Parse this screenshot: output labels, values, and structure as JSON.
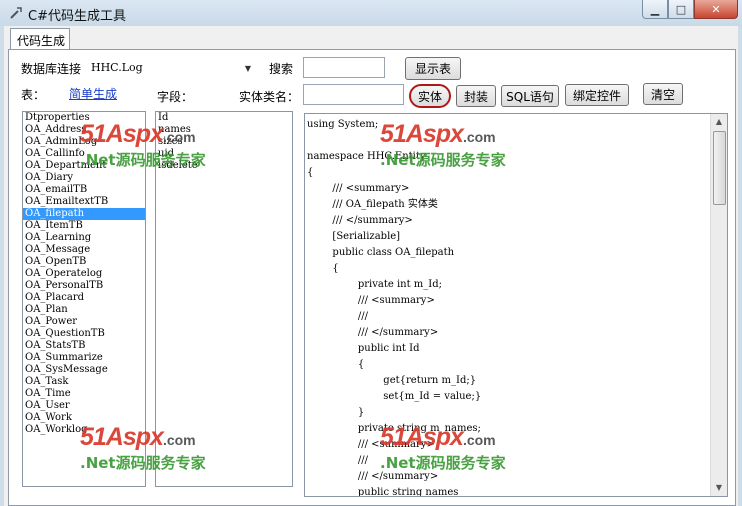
{
  "window": {
    "title": "C#代码生成工具",
    "minimize": "▁",
    "maximize": "□",
    "close": "✕"
  },
  "tab": {
    "label": "代码生成"
  },
  "toolbar": {
    "db_label": "数据库连接",
    "db_value": "HHC.Log",
    "search_label": "搜索",
    "search_value": "",
    "show_tables_button": "显示表",
    "table_label": "表：",
    "simple_generate_link": "简单生成",
    "fields_label": "字段：",
    "entity_class_label": "实体类名：",
    "entity_class_value": "",
    "entity_button": "实体",
    "encapsulate_button": "封装",
    "sql_button": "SQL语句",
    "bind_controls_button": "绑定控件",
    "clear_button": "清空"
  },
  "tables": [
    "Dtproperties",
    "OA_Address",
    "OA_AdminLog",
    "OA_Callinfo",
    "OA_Department",
    "OA_Diary",
    "OA_emailTB",
    "OA_EmailtextTB",
    "OA_filepath",
    "OA_ItemTB",
    "OA_Learning",
    "OA_Message",
    "OA_OpenTB",
    "OA_Operatelog",
    "OA_PersonalTB",
    "OA_Placard",
    "OA_Plan",
    "OA_Power",
    "OA_QuestionTB",
    "OA_StatsTB",
    "OA_Summarize",
    "OA_SysMessage",
    "OA_Task",
    "OA_Time",
    "OA_User",
    "OA_Work",
    "OA_Worklog"
  ],
  "selected_table": "OA_filepath",
  "fields": [
    "Id",
    "names",
    "sizes",
    "uid",
    "isdelete"
  ],
  "code_lines": [
    "using System;",
    "",
    "namespace HHC.Entity",
    "{",
    "        /// <summary>",
    "        /// OA_filepath 实体类",
    "        /// </summary>",
    "        [Serializable]",
    "        public class OA_filepath",
    "        {",
    "                private int m_Id;",
    "                /// <summary>",
    "                ///",
    "                /// </summary>",
    "                public int Id",
    "                {",
    "                        get{return m_Id;}",
    "                        set{m_Id = value;}",
    "                }",
    "                private string m_names;",
    "                /// <summary>",
    "                ///",
    "                /// </summary>",
    "                public string names"
  ],
  "watermark": {
    "logo": "51Aspx",
    "domain": ".com",
    "slogan": ".Net源码服务专家"
  },
  "icons": {
    "app": "tool-icon",
    "dropdown": "chevron-down-icon",
    "scroll_up": "arrow-up-icon",
    "scroll_down": "arrow-down-icon"
  }
}
